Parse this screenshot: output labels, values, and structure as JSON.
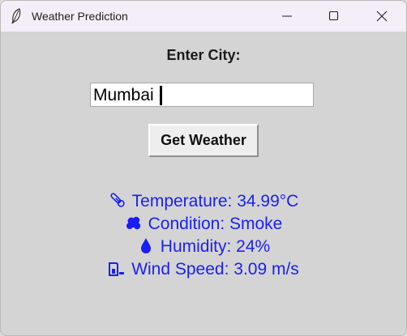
{
  "window": {
    "title": "Weather Prediction"
  },
  "form": {
    "label": "Enter City:",
    "city_value": "Mumbai",
    "button_label": "Get Weather"
  },
  "results": {
    "temperature": "Temperature: 34.99°C",
    "condition": "Condition: Smoke",
    "humidity": "Humidity: 24%",
    "wind": "Wind Speed: 3.09 m/s"
  },
  "icons": {
    "temperature": "thermometer-icon",
    "condition": "cloud-icon",
    "humidity": "droplet-icon",
    "wind": "wind-icon"
  },
  "colors": {
    "result_text": "#1a1ff5",
    "background": "#d4d4d4"
  }
}
